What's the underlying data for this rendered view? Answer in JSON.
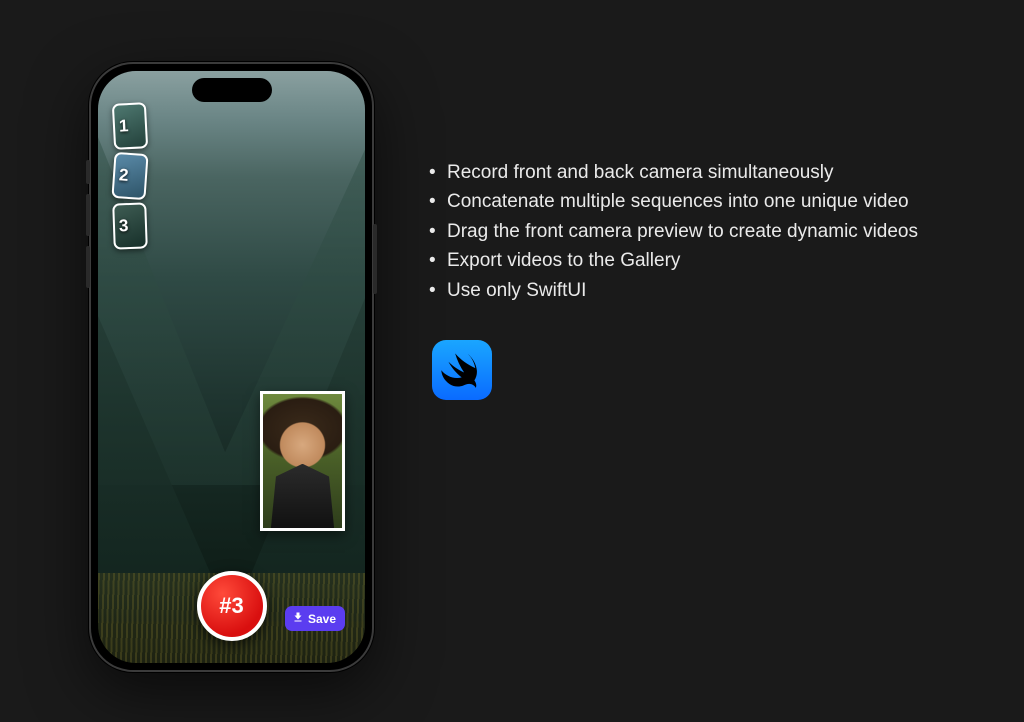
{
  "phone": {
    "thumbnails": [
      "1",
      "2",
      "3"
    ],
    "record_label": "#3",
    "save_label": "Save"
  },
  "features": {
    "items": [
      "Record front and back camera simultaneously",
      "Concatenate multiple sequences into one unique video",
      "Drag the front camera preview to create dynamic videos",
      "Export videos to the Gallery",
      "Use only SwiftUI"
    ]
  },
  "icons": {
    "swiftui": "swiftui-icon",
    "download": "download-icon"
  }
}
